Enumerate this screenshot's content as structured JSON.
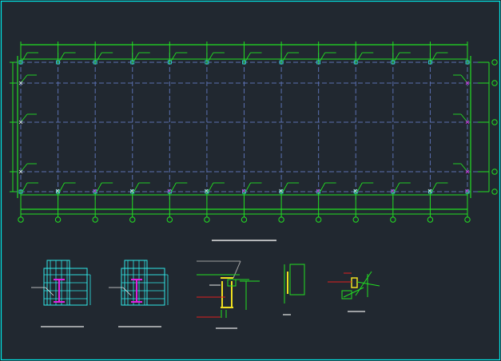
{
  "window": {
    "title": ""
  },
  "colors": {
    "background": "#212830",
    "frame": "#00e5e5",
    "gridline_dash": "#5a6fb0",
    "steel": "#22e022",
    "cyan": "#30e8e8",
    "magenta": "#e020e0",
    "yellow": "#f0e020",
    "red": "#e02020",
    "white": "#e8e8e8",
    "gray": "#a0a0a0"
  },
  "plan": {
    "bay_count": 12,
    "row_lines": 5,
    "column_labels": [],
    "row_labels": []
  },
  "details": [
    {
      "id": "base-plate-detail-1"
    },
    {
      "id": "base-plate-detail-2"
    },
    {
      "id": "column-beam-connection"
    },
    {
      "id": "stiffener-section"
    },
    {
      "id": "brace-gusset"
    }
  ]
}
